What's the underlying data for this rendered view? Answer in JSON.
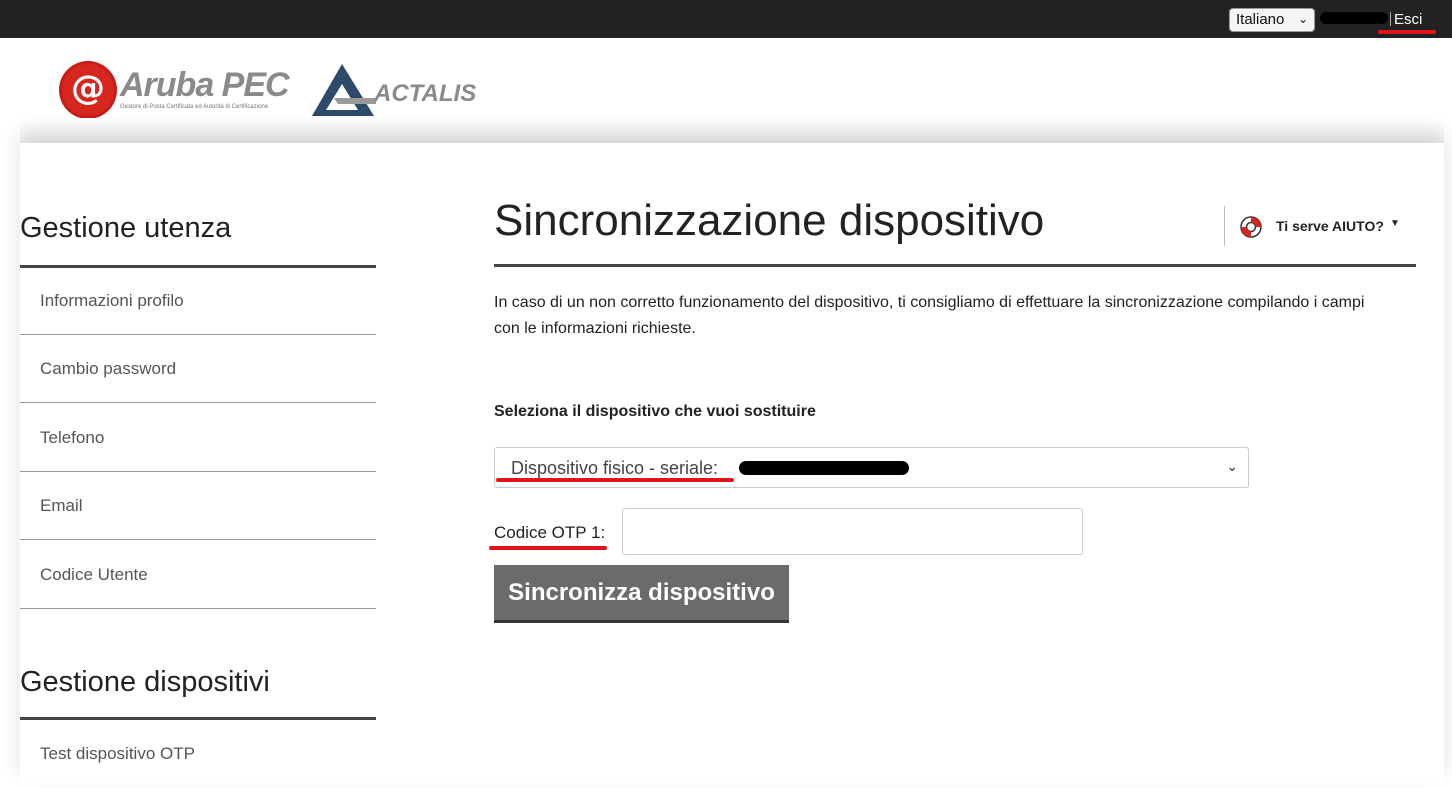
{
  "topbar": {
    "language": "Italiano",
    "logout_label": "Esci"
  },
  "logos": {
    "aruba_brand": "Aruba PEC",
    "aruba_tagline": "Gestore di Posta Certificata ed Autorità di Certificazione",
    "actalis_brand": "ACTALIS"
  },
  "sidebar": {
    "sections": [
      {
        "heading": "Gestione utenza",
        "items": [
          {
            "label": "Informazioni profilo"
          },
          {
            "label": "Cambio password"
          },
          {
            "label": "Telefono"
          },
          {
            "label": "Email"
          },
          {
            "label": "Codice Utente"
          }
        ]
      },
      {
        "heading": "Gestione dispositivi",
        "items": [
          {
            "label": "Test dispositivo OTP"
          }
        ]
      }
    ]
  },
  "main": {
    "title": "Sincronizzazione dispositivo",
    "help_label": "Ti serve AIUTO?",
    "intro": "In caso di un non corretto funzionamento del dispositivo, ti consigliamo di effettuare la sincronizzazione compilando i campi con le informazioni richieste.",
    "device_field_label": "Seleziona il dispositivo che vuoi sostituire",
    "device_selected": "Dispositivo fisico - seriale:",
    "otp_label": "Codice OTP 1:",
    "otp_value": "",
    "submit_label": "Sincronizza dispositivo"
  },
  "colors": {
    "topbar": "#222222",
    "annotation_red": "#e2141a",
    "button": "#6b6b6b"
  }
}
